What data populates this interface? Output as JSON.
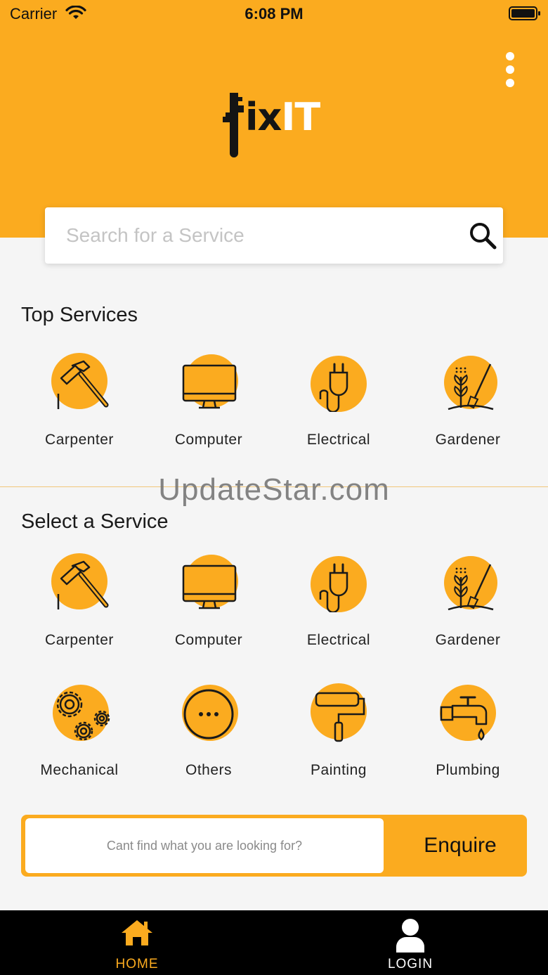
{
  "status_bar": {
    "carrier": "Carrier",
    "time": "6:08 PM",
    "wifi_icon": "wifi-icon",
    "battery_icon": "battery-icon"
  },
  "header": {
    "background": "#fbab1f",
    "menu_icon": "kebab-icon",
    "logo": {
      "text_dark": "ix",
      "text_light": "IT"
    }
  },
  "search": {
    "placeholder": "Search for a Service",
    "value": "",
    "icon": "search-icon"
  },
  "top_services": {
    "title": "Top Services",
    "items": [
      {
        "label": "Carpenter",
        "icon": "hammer-icon"
      },
      {
        "label": "Computer",
        "icon": "monitor-icon"
      },
      {
        "label": "Electrical",
        "icon": "plug-icon"
      },
      {
        "label": "Gardener",
        "icon": "plant-shovel-icon"
      }
    ]
  },
  "watermark": "UpdateStar.com",
  "select_service": {
    "title": "Select a Service",
    "items": [
      {
        "label": "Carpenter",
        "icon": "hammer-icon"
      },
      {
        "label": "Computer",
        "icon": "monitor-icon"
      },
      {
        "label": "Electrical",
        "icon": "plug-icon"
      },
      {
        "label": "Gardener",
        "icon": "plant-shovel-icon"
      },
      {
        "label": "Mechanical",
        "icon": "gears-icon"
      },
      {
        "label": "Others",
        "icon": "more-dots-icon"
      },
      {
        "label": "Painting",
        "icon": "paint-roller-icon"
      },
      {
        "label": "Plumbing",
        "icon": "faucet-icon"
      }
    ]
  },
  "enquire": {
    "placeholder": "Cant find what you are looking for?",
    "value": "",
    "button_label": "Enquire"
  },
  "tabbar": {
    "active_color": "#fbab1f",
    "tabs": [
      {
        "label": "HOME",
        "icon": "home-icon",
        "active": true
      },
      {
        "label": "LOGIN",
        "icon": "user-icon",
        "active": false
      }
    ]
  }
}
